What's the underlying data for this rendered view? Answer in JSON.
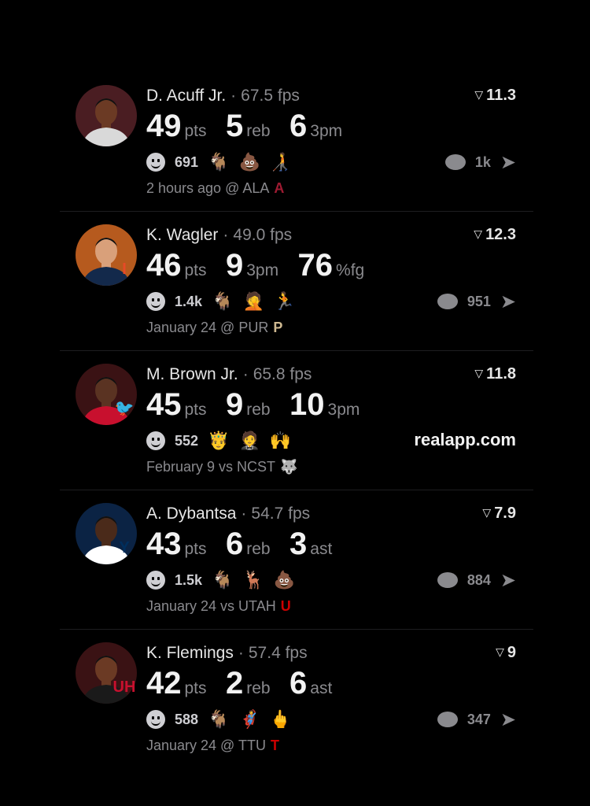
{
  "feed": [
    {
      "player": "D. Acuff Jr.",
      "sep": "·",
      "fps": "67.5 fps",
      "rating": "11.3",
      "avatar_colors": {
        "bg": "#4a1d22",
        "skin": "#6b3a24",
        "jersey": "#d9d9d9"
      },
      "stats": [
        {
          "value": "49",
          "unit": "pts"
        },
        {
          "value": "5",
          "unit": "reb"
        },
        {
          "value": "6",
          "unit": "3pm"
        }
      ],
      "reactions_count": "691",
      "reaction_emojis": [
        "🐐",
        "💩",
        "🧑‍🦯"
      ],
      "comments": "1k",
      "footer": "2 hours ago @ ALA",
      "team_logo": {
        "text": "A",
        "color": "#9e1b32"
      },
      "badge": {
        "text": "",
        "color": "#9e1b32"
      }
    },
    {
      "player": "K. Wagler",
      "sep": "·",
      "fps": "49.0 fps",
      "rating": "12.3",
      "avatar_colors": {
        "bg": "#b65a1e",
        "skin": "#d9a07a",
        "jersey": "#13294b"
      },
      "stats": [
        {
          "value": "46",
          "unit": "pts"
        },
        {
          "value": "9",
          "unit": "3pm"
        },
        {
          "value": "76",
          "unit": "%fg"
        }
      ],
      "reactions_count": "1.4k",
      "reaction_emojis": [
        "🐐",
        "🤦",
        "🏃"
      ],
      "comments": "951",
      "footer": "January 24 @ PUR",
      "team_logo": {
        "text": "P",
        "color": "#cfb991"
      },
      "badge": {
        "text": "I",
        "color": "#e84a27"
      }
    },
    {
      "player": "M. Brown Jr.",
      "sep": "·",
      "fps": "65.8 fps",
      "rating": "11.8",
      "avatar_colors": {
        "bg": "#3a1214",
        "skin": "#5a3322",
        "jersey": "#c8102e"
      },
      "stats": [
        {
          "value": "45",
          "unit": "pts"
        },
        {
          "value": "9",
          "unit": "reb"
        },
        {
          "value": "10",
          "unit": "3pm"
        }
      ],
      "reactions_count": "552",
      "reaction_emojis": [
        "🤴",
        "🤵",
        "🙌"
      ],
      "promo": "realapp.com",
      "footer": "February 9 vs NCST",
      "team_logo": {
        "text": "🐺",
        "color": "#cc0000"
      },
      "badge": {
        "text": "🐦",
        "color": "#c8102e"
      }
    },
    {
      "player": "A. Dybantsa",
      "sep": "·",
      "fps": "54.7 fps",
      "rating": "7.9",
      "avatar_colors": {
        "bg": "#0b2344",
        "skin": "#4a2a1a",
        "jersey": "#ffffff"
      },
      "stats": [
        {
          "value": "43",
          "unit": "pts"
        },
        {
          "value": "6",
          "unit": "reb"
        },
        {
          "value": "3",
          "unit": "ast"
        }
      ],
      "reactions_count": "1.5k",
      "reaction_emojis": [
        "🐐",
        "🦌",
        "💩"
      ],
      "comments": "884",
      "footer": "January 24 vs UTAH",
      "team_logo": {
        "text": "U",
        "color": "#cc0000"
      },
      "badge": {
        "text": "Y",
        "color": "#002e5d"
      }
    },
    {
      "player": "K. Flemings",
      "sep": "·",
      "fps": "57.4 fps",
      "rating": "9",
      "avatar_colors": {
        "bg": "#3a1214",
        "skin": "#6b3a24",
        "jersey": "#1a1a1a"
      },
      "stats": [
        {
          "value": "42",
          "unit": "pts"
        },
        {
          "value": "2",
          "unit": "reb"
        },
        {
          "value": "6",
          "unit": "ast"
        }
      ],
      "reactions_count": "588",
      "reaction_emojis": [
        "🐐",
        "🦸",
        "🖕"
      ],
      "comments": "347",
      "footer": "January 24 @ TTU",
      "team_logo": {
        "text": "T",
        "color": "#cc0000"
      },
      "badge": {
        "text": "UH",
        "color": "#c8102e"
      }
    }
  ],
  "icons": {
    "rating": "triangle-down-icon",
    "reactions": "smile-icon",
    "comments": "chat-bubble-icon",
    "share": "send-arrow-icon"
  }
}
